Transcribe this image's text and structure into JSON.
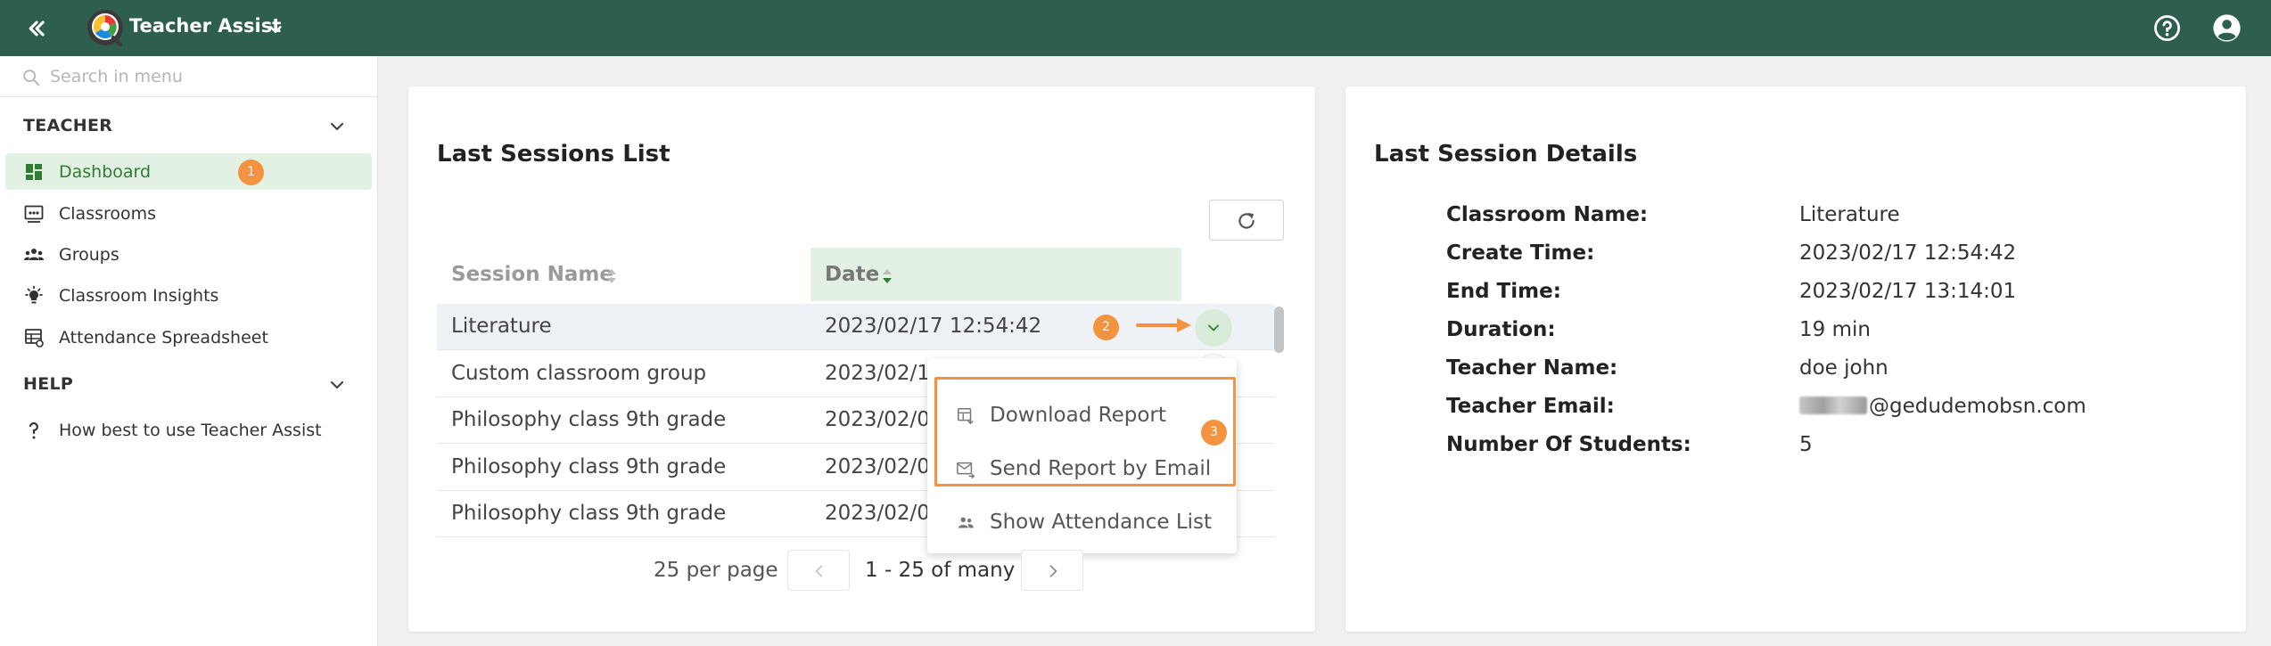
{
  "header": {
    "app_title": "Teacher Assist",
    "icons": [
      "double-chevron-left-icon",
      "app-logo-icon",
      "chevron-down-icon",
      "help-circle-icon",
      "account-circle-icon"
    ],
    "color": "#2d5e4e"
  },
  "sidebar": {
    "search_placeholder": "Search in menu",
    "sections": [
      {
        "title": "TEACHER",
        "items": [
          {
            "label": "Dashboard",
            "icon": "dashboard-icon",
            "active": true,
            "badge": "1"
          },
          {
            "label": "Classrooms",
            "icon": "classroom-icon"
          },
          {
            "label": "Groups",
            "icon": "groups-icon"
          },
          {
            "label": "Classroom Insights",
            "icon": "lightbulb-icon"
          },
          {
            "label": "Attendance Spreadsheet",
            "icon": "spreadsheet-icon"
          }
        ]
      },
      {
        "title": "HELP",
        "items": [
          {
            "label": "How best to use Teacher Assist",
            "icon": "question-mark-icon"
          }
        ]
      }
    ]
  },
  "sessions": {
    "title": "Last Sessions List",
    "columns": [
      "Session Name",
      "Date"
    ],
    "rows": [
      {
        "name": "Literature",
        "date": "2023/02/17 12:54:42"
      },
      {
        "name": "Custom classroom group",
        "date": "2023/02/1"
      },
      {
        "name": "Philosophy class 9th grade",
        "date": "2023/02/0"
      },
      {
        "name": "Philosophy class 9th grade",
        "date": "2023/02/0"
      },
      {
        "name": "Philosophy class 9th grade",
        "date": "2023/02/0"
      }
    ],
    "menu": [
      {
        "label": "Download Report",
        "icon": "report-download-icon"
      },
      {
        "label": "Send Report by Email",
        "icon": "email-send-icon"
      },
      {
        "label": "Show Attendance List",
        "icon": "people-icon"
      }
    ],
    "step_badges": [
      "2",
      "3"
    ],
    "pagination": {
      "per_page": "25 per page",
      "range": "1 - 25 of many"
    }
  },
  "details": {
    "title": "Last Session Details",
    "fields": [
      {
        "label": "Classroom Name:",
        "value": "Literature"
      },
      {
        "label": "Create Time:",
        "value": "2023/02/17 12:54:42"
      },
      {
        "label": "End Time:",
        "value": "2023/02/17 13:14:01"
      },
      {
        "label": "Duration:",
        "value": "19 min"
      },
      {
        "label": "Teacher Name:",
        "value": "doe john"
      },
      {
        "label": "Teacher Email:",
        "value": "@gedudemobsn.com"
      },
      {
        "label": "Number Of Students:",
        "value": "5"
      }
    ]
  },
  "colors": {
    "accent_orange": "#f4933f",
    "active_green": "#2e7d32",
    "active_bg": "#e3f1e4"
  }
}
